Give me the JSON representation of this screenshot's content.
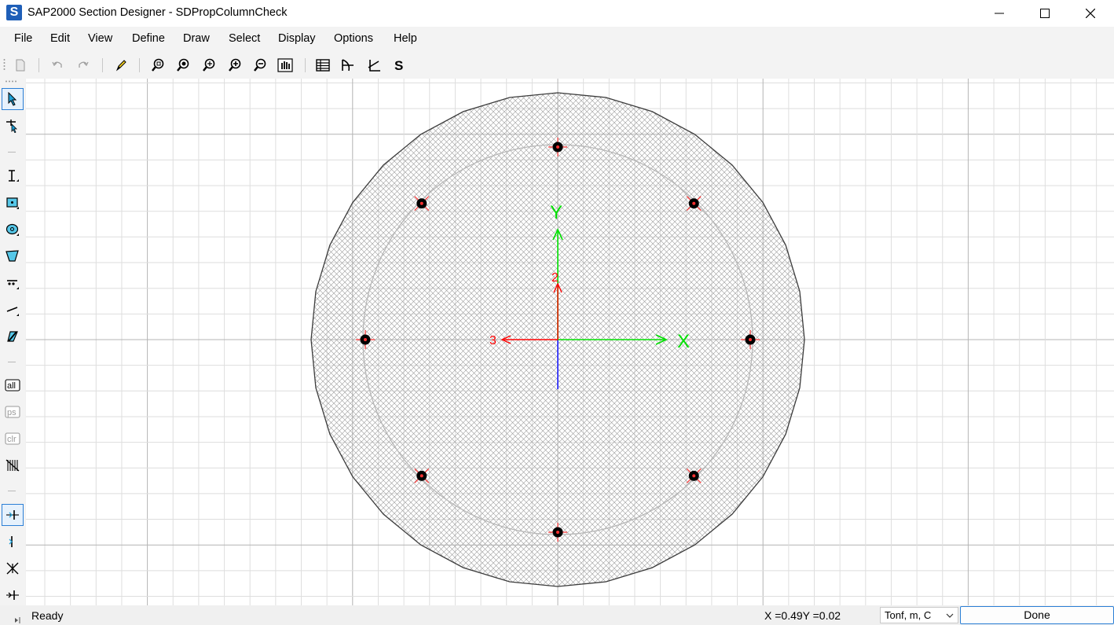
{
  "window": {
    "app_letter": "S",
    "title": "SAP2000 Section Designer - SDPropColumnCheck"
  },
  "menu": [
    "File",
    "Edit",
    "View",
    "Define",
    "Draw",
    "Select",
    "Display",
    "Options",
    "Help"
  ],
  "left_tools": {
    "all_label": "all",
    "ps_label": "ps",
    "clr_label": "clr"
  },
  "canvas": {
    "axis_labels": {
      "y": "Y",
      "x": "X",
      "local_2": "2",
      "local_3": "3"
    },
    "colors": {
      "global_axis": "#00e000",
      "local_axis": "#ff0000",
      "axis_3": "#0000ff",
      "hatch": "#9a9a9a",
      "rebar": "#000000"
    }
  },
  "status": {
    "text": "Ready",
    "coords": "X =0.49Y =0.02",
    "units": "Tonf, m, C",
    "done_label": "Done"
  }
}
